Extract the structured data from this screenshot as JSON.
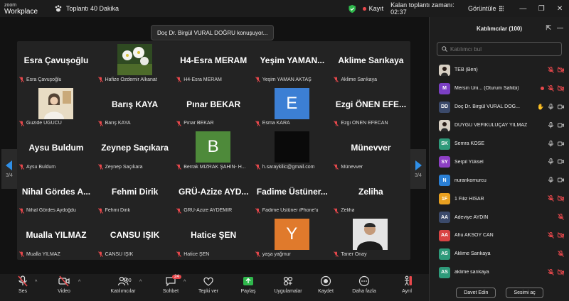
{
  "titlebar": {
    "logo_line1": "zoom",
    "logo_line2": "Workplace",
    "meeting_name": "Toplantı 40 Dakika",
    "recording": "Kayıt",
    "remaining": "Kalan toplantı zamanı: 02:37",
    "view": "Görüntüle",
    "minimize": "—",
    "restore": "❐",
    "close": "✕"
  },
  "stage": {
    "speaking": "Doç Dr. Birgül VURAL DOĞRU konuşuyor...",
    "page_left": "3/4",
    "page_right": "3/4",
    "tiles": [
      {
        "big": "Esra Çavuşoğlu",
        "label": "Esra Çavuşoğlu"
      },
      {
        "big": "",
        "label": "Hafize Özdemir Alkanat",
        "photo": "flowers"
      },
      {
        "big": "H4-Esra MERAM",
        "label": "H4-Esra MERAM"
      },
      {
        "big": "Yeşim YAMAN...",
        "label": "Yeşim YAMAN AKTAŞ"
      },
      {
        "big": "Aklime Sarıkaya",
        "label": "Aklime Sarıkaya"
      },
      {
        "big": "",
        "label": "Guzide UGUCU",
        "photo": "woman"
      },
      {
        "big": "Barış KAYA",
        "label": "Barış KAYA"
      },
      {
        "big": "Pınar BEKAR",
        "label": "Pınar BEKAR"
      },
      {
        "big": "",
        "label": "Esma KARA",
        "avatar": "E",
        "color": "#3c7fd4"
      },
      {
        "big": "Ezgi ÖNEN EFE...",
        "label": "Ezgi ÖNEN EFECAN"
      },
      {
        "big": "Aysu Buldum",
        "label": "Aysu Buldum"
      },
      {
        "big": "Zeynep Saçıkara",
        "label": "Zeynep Saçıkara"
      },
      {
        "big": "",
        "label": "Berrak MIZRAK ŞAHİN- H...",
        "avatar": "B",
        "color": "#4e8a3a"
      },
      {
        "big": "",
        "label": "h.saraykilic@gmail.com",
        "photo": "dark"
      },
      {
        "big": "Münevver",
        "label": "Münevver"
      },
      {
        "big": "Nihal Gördes A...",
        "label": "Nihal Gördes Aydoğdu"
      },
      {
        "big": "Fehmi Dirik",
        "label": "Fehmi Dirik"
      },
      {
        "big": "GRÜ-Azize AYD...",
        "label": "GRÜ-Azize AYDEMİR"
      },
      {
        "big": "Fadime Üstüner...",
        "label": "Fadime Üstüner iPhone'u"
      },
      {
        "big": "Zeliha",
        "label": "Zeliha"
      },
      {
        "big": "Mualla YILMAZ",
        "label": "Mualla YILMAZ"
      },
      {
        "big": "CANSU IŞIK",
        "label": "CANSU IŞIK"
      },
      {
        "big": "Hatice ŞEN",
        "label": "Hatice ŞEN"
      },
      {
        "big": "",
        "label": "yaşa yağmur",
        "avatar": "Y",
        "color": "#e07a2c"
      },
      {
        "big": "",
        "label": "Taner Onay",
        "photo": "man"
      }
    ]
  },
  "toolbar": {
    "audio": "Ses",
    "video": "Video",
    "participants": "Katılımcılar",
    "participants_count": "100",
    "chat": "Sohbet",
    "chat_badge": "24",
    "react": "Tepki ver",
    "share": "Paylaş",
    "apps": "Uygulamalar",
    "record": "Kaydet",
    "more": "Daha fazla",
    "leave": "Ayrıl"
  },
  "panel": {
    "title": "Katılımcılar (100)",
    "search_placeholder": "Katılımcı bul",
    "invite": "Davet Edin",
    "mute_all": "Sesimi aç",
    "participants": [
      {
        "initials": "",
        "name": "TEB (Ben)",
        "color": "#333",
        "photo": true,
        "mic": "muted",
        "cam": "off"
      },
      {
        "initials": "M",
        "name": "Mersin Üni... (Oturum Sahibi)",
        "color": "#7b3fc4",
        "mic": "muted",
        "cam": "off",
        "rec": true
      },
      {
        "initials": "DD",
        "name": "Doç Dr. Birgül VURAL DOĞ...",
        "color": "#3b4a6b",
        "mic": "on",
        "cam": "on",
        "hand": true
      },
      {
        "initials": "",
        "name": "DUYGU VEFİKULUÇAY YILMAZ",
        "color": "#555",
        "photo": true,
        "mic": "on",
        "cam": "on"
      },
      {
        "initials": "SK",
        "name": "Semra KÖSE",
        "color": "#2e9a7a",
        "mic": "on",
        "cam": "on"
      },
      {
        "initials": "SY",
        "name": "Serpil Yüksel",
        "color": "#8d3fc4",
        "mic": "on",
        "cam": "on"
      },
      {
        "initials": "N",
        "name": "nurankomurcu",
        "color": "#2a7fd4",
        "mic": "on",
        "cam": "on"
      },
      {
        "initials": "1F",
        "name": "1 Filiz HİSAR",
        "color": "#e8a020",
        "mic": "muted",
        "cam": "off"
      },
      {
        "initials": "AA",
        "name": "Adeviye AYDIN",
        "color": "#3b4a6b",
        "mic": "muted",
        "cam": "none"
      },
      {
        "initials": "AA",
        "name": "Ahu AKSOY CAN",
        "color": "#d84343",
        "mic": "muted",
        "cam": "off"
      },
      {
        "initials": "AS",
        "name": "Aklime Sarıkaya",
        "color": "#2e9a7a",
        "mic": "muted",
        "cam": "none"
      },
      {
        "initials": "AS",
        "name": "aklime sarıkaya",
        "color": "#2e9a7a",
        "mic": "muted",
        "cam": "off"
      }
    ]
  }
}
